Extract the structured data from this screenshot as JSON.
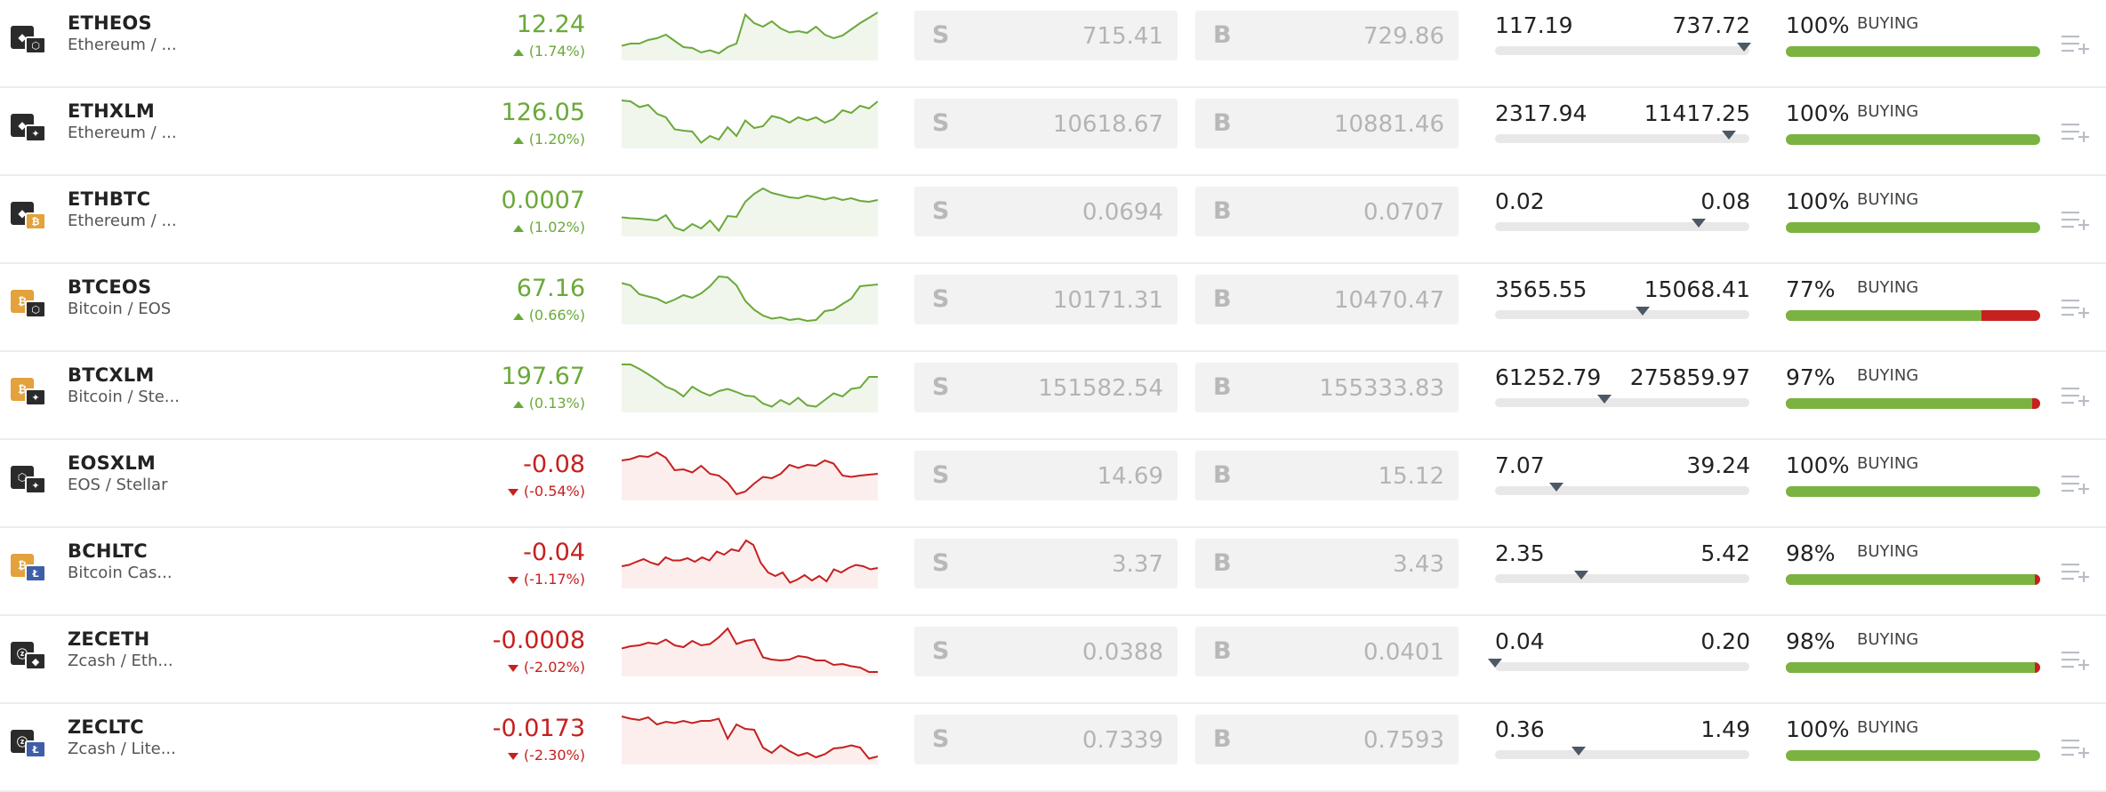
{
  "colors": {
    "up": "#6aa93a",
    "down": "#c6201f",
    "buy_bar": "#7bb342",
    "sell_bar": "#c6201f",
    "eth": "#2b2b2b",
    "btc": "#e3a23b",
    "eos": "#2b2b2b",
    "xlm": "#2b2b2b",
    "ltc": "#3e5fa8",
    "bch": "#e3a23b",
    "zec": "#2b2b2b"
  },
  "rows": [
    {
      "symbol": "ETHEOS",
      "name": "Ethereum / ...",
      "base_icon": "ethereum-icon",
      "quote_icon": "eos-icon",
      "base_glyph": "◆",
      "quote_glyph": "⬡",
      "base_color": "#2b2b2b",
      "quote_color": "#2b2b2b",
      "price": "12.24",
      "change": "(1.74%)",
      "direction": "up",
      "spark": [
        0.25,
        0.3,
        0.3,
        0.38,
        0.42,
        0.5,
        0.36,
        0.22,
        0.2,
        0.1,
        0.15,
        0.08,
        0.22,
        0.3,
        0.95,
        0.76,
        0.68,
        0.8,
        0.64,
        0.55,
        0.58,
        0.54,
        0.68,
        0.5,
        0.42,
        0.48,
        0.62,
        0.76,
        0.88,
        1.0
      ],
      "sell": "715.41",
      "buy": "729.86",
      "low": "117.19",
      "high": "737.72",
      "range_pos": 0.98,
      "sentiment_pct": "100%",
      "sentiment_label": "BUYING",
      "buy_share": 1.0
    },
    {
      "symbol": "ETHXLM",
      "name": "Ethereum / ...",
      "base_icon": "ethereum-icon",
      "quote_icon": "stellar-icon",
      "base_glyph": "◆",
      "quote_glyph": "✦",
      "base_color": "#2b2b2b",
      "quote_color": "#2b2b2b",
      "price": "126.05",
      "change": "(1.20%)",
      "direction": "up",
      "spark": [
        1.0,
        0.98,
        0.85,
        0.9,
        0.7,
        0.62,
        0.35,
        0.32,
        0.3,
        0.05,
        0.2,
        0.12,
        0.4,
        0.2,
        0.55,
        0.38,
        0.42,
        0.65,
        0.6,
        0.5,
        0.62,
        0.55,
        0.62,
        0.5,
        0.58,
        0.78,
        0.72,
        0.88,
        0.82,
        0.98
      ],
      "sell": "10618.67",
      "buy": "10881.46",
      "low": "2317.94",
      "high": "11417.25",
      "range_pos": 0.92,
      "sentiment_pct": "100%",
      "sentiment_label": "BUYING",
      "buy_share": 1.0
    },
    {
      "symbol": "ETHBTC",
      "name": "Ethereum / ...",
      "base_icon": "ethereum-icon",
      "quote_icon": "bitcoin-icon",
      "base_glyph": "◆",
      "quote_glyph": "₿",
      "base_color": "#2b2b2b",
      "quote_color": "#e3a23b",
      "price": "0.0007",
      "change": "(1.02%)",
      "direction": "up",
      "spark": [
        0.35,
        0.33,
        0.32,
        0.3,
        0.28,
        0.4,
        0.12,
        0.05,
        0.2,
        0.1,
        0.28,
        0.05,
        0.38,
        0.36,
        0.7,
        0.88,
        1.0,
        0.9,
        0.85,
        0.8,
        0.78,
        0.84,
        0.8,
        0.75,
        0.8,
        0.74,
        0.78,
        0.72,
        0.7,
        0.74
      ],
      "sell": "0.0694",
      "buy": "0.0707",
      "low": "0.02",
      "high": "0.08",
      "range_pos": 0.8,
      "sentiment_pct": "100%",
      "sentiment_label": "BUYING",
      "buy_share": 1.0
    },
    {
      "symbol": "BTCEOS",
      "name": "Bitcoin / EOS",
      "base_icon": "bitcoin-icon",
      "quote_icon": "eos-icon",
      "base_glyph": "₿",
      "quote_glyph": "⬡",
      "base_color": "#e3a23b",
      "quote_color": "#2b2b2b",
      "price": "67.16",
      "change": "(0.66%)",
      "direction": "up",
      "spark": [
        0.85,
        0.8,
        0.6,
        0.55,
        0.5,
        0.4,
        0.48,
        0.58,
        0.52,
        0.62,
        0.78,
        1.0,
        0.98,
        0.8,
        0.45,
        0.25,
        0.12,
        0.05,
        0.08,
        0.02,
        0.05,
        0.0,
        0.02,
        0.22,
        0.25,
        0.38,
        0.5,
        0.78,
        0.8,
        0.82
      ],
      "sell": "10171.31",
      "buy": "10470.47",
      "low": "3565.55",
      "high": "15068.41",
      "range_pos": 0.58,
      "sentiment_pct": "77%",
      "sentiment_label": "BUYING",
      "buy_share": 0.77
    },
    {
      "symbol": "BTCXLM",
      "name": "Bitcoin / Ste...",
      "base_icon": "bitcoin-icon",
      "quote_icon": "stellar-icon",
      "base_glyph": "₿",
      "quote_glyph": "✦",
      "base_color": "#e3a23b",
      "quote_color": "#2b2b2b",
      "price": "197.67",
      "change": "(0.13%)",
      "direction": "up",
      "spark": [
        1.0,
        1.0,
        0.9,
        0.78,
        0.65,
        0.5,
        0.42,
        0.28,
        0.5,
        0.38,
        0.3,
        0.4,
        0.45,
        0.38,
        0.3,
        0.28,
        0.12,
        0.05,
        0.2,
        0.1,
        0.25,
        0.08,
        0.05,
        0.2,
        0.35,
        0.28,
        0.45,
        0.48,
        0.72,
        0.72
      ],
      "sell": "151582.54",
      "buy": "155333.83",
      "low": "61252.79",
      "high": "275859.97",
      "range_pos": 0.43,
      "sentiment_pct": "97%",
      "sentiment_label": "BUYING",
      "buy_share": 0.97
    },
    {
      "symbol": "EOSXLM",
      "name": "EOS / Stellar",
      "base_icon": "eos-icon",
      "quote_icon": "stellar-icon",
      "base_glyph": "⬡",
      "quote_glyph": "✦",
      "base_color": "#2b2b2b",
      "quote_color": "#2b2b2b",
      "price": "-0.08",
      "change": "(-0.54%)",
      "direction": "down",
      "spark": [
        0.82,
        0.85,
        0.92,
        0.9,
        1.0,
        0.88,
        0.6,
        0.62,
        0.55,
        0.7,
        0.52,
        0.48,
        0.32,
        0.06,
        0.12,
        0.3,
        0.45,
        0.42,
        0.52,
        0.72,
        0.65,
        0.72,
        0.7,
        0.82,
        0.75,
        0.48,
        0.45,
        0.48,
        0.5,
        0.52
      ],
      "sell": "14.69",
      "buy": "15.12",
      "low": "7.07",
      "high": "39.24",
      "range_pos": 0.24,
      "sentiment_pct": "100%",
      "sentiment_label": "BUYING",
      "buy_share": 1.0
    },
    {
      "symbol": "BCHLTC",
      "name": "Bitcoin Cas...",
      "base_icon": "bitcoin-cash-icon",
      "quote_icon": "litecoin-icon",
      "base_glyph": "₿",
      "quote_glyph": "Ł",
      "base_color": "#e3a23b",
      "quote_color": "#3e5fa8",
      "price": "-0.04",
      "change": "(-1.17%)",
      "direction": "down",
      "spark": [
        0.42,
        0.45,
        0.52,
        0.58,
        0.5,
        0.45,
        0.62,
        0.55,
        0.55,
        0.6,
        0.52,
        0.62,
        0.55,
        0.75,
        0.68,
        0.8,
        0.76,
        1.0,
        0.9,
        0.5,
        0.28,
        0.2,
        0.28,
        0.05,
        0.12,
        0.22,
        0.1,
        0.2,
        0.08,
        0.35,
        0.28,
        0.38,
        0.45,
        0.42,
        0.35,
        0.38
      ],
      "sell": "3.37",
      "buy": "3.43",
      "low": "2.35",
      "high": "5.42",
      "range_pos": 0.34,
      "sentiment_pct": "98%",
      "sentiment_label": "BUYING",
      "buy_share": 0.98
    },
    {
      "symbol": "ZECETH",
      "name": "Zcash / Eth...",
      "base_icon": "zcash-icon",
      "quote_icon": "ethereum-icon",
      "base_glyph": "ⓩ",
      "quote_glyph": "◆",
      "base_color": "#2b2b2b",
      "quote_color": "#2b2b2b",
      "price": "-0.0008",
      "change": "(-2.02%)",
      "direction": "down",
      "spark": [
        0.55,
        0.6,
        0.62,
        0.68,
        0.65,
        0.75,
        0.62,
        0.58,
        0.72,
        0.62,
        0.65,
        0.8,
        1.0,
        0.65,
        0.72,
        0.75,
        0.35,
        0.3,
        0.28,
        0.3,
        0.38,
        0.35,
        0.28,
        0.28,
        0.18,
        0.2,
        0.15,
        0.12,
        0.02,
        0.02
      ],
      "sell": "0.0388",
      "buy": "0.0401",
      "low": "0.04",
      "high": "0.20",
      "range_pos": 0.0,
      "sentiment_pct": "98%",
      "sentiment_label": "BUYING",
      "buy_share": 0.98
    },
    {
      "symbol": "ZECLTC",
      "name": "Zcash / Lite...",
      "base_icon": "zcash-icon",
      "quote_icon": "litecoin-icon",
      "base_glyph": "ⓩ",
      "quote_glyph": "Ł",
      "base_color": "#2b2b2b",
      "quote_color": "#3e5fa8",
      "price": "-0.0173",
      "change": "(-2.30%)",
      "direction": "down",
      "spark": [
        1.0,
        0.95,
        0.92,
        0.98,
        0.82,
        0.88,
        0.85,
        0.9,
        0.85,
        0.9,
        0.9,
        0.95,
        0.5,
        0.82,
        0.72,
        0.7,
        0.3,
        0.18,
        0.35,
        0.22,
        0.12,
        0.18,
        0.08,
        0.15,
        0.28,
        0.3,
        0.35,
        0.3,
        0.05,
        0.1
      ],
      "sell": "0.7339",
      "buy": "0.7593",
      "low": "0.36",
      "high": "1.49",
      "range_pos": 0.33,
      "sentiment_pct": "100%",
      "sentiment_label": "BUYING",
      "buy_share": 1.0
    }
  ],
  "labels": {
    "sell_letter": "S",
    "buy_letter": "B"
  }
}
